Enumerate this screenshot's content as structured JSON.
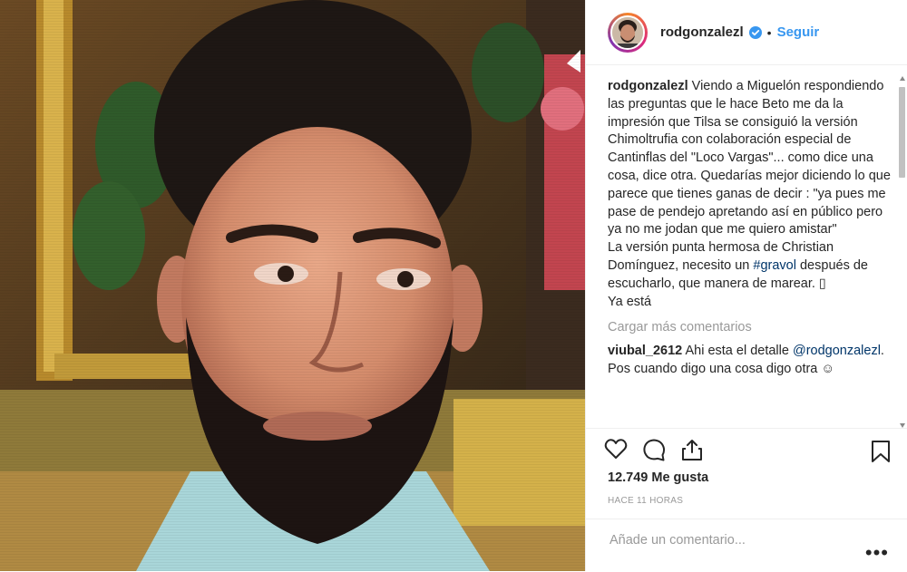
{
  "post": {
    "username": "rodgonzalezl",
    "dot": "•",
    "follow_label": "Seguir",
    "caption": "Viendo a Miguelón respondiendo las preguntas que le hace Beto me da la impresión que Tilsa se consiguió la versión Chimoltrufia con colaboración especial de Cantinflas del \"Loco Vargas\"... como dice una cosa, dice otra. Quedarías mejor diciendo lo que parece que tienes ganas de decir : \"ya pues me pase de pendejo apretando así en público pero ya no me jodan que me quiero amistar\"\nLa versión punta hermosa de Christian Domínguez, necesito un ",
    "caption_hashtag": "#gravol",
    "caption_end": " después de escucharlo, que manera de marear. ▯\nYa está",
    "load_more": "Cargar más comentarios",
    "comments": [
      {
        "username": "viubal_2612",
        "text_before": " Ahi esta el detalle ",
        "mention": "@rodgonzalezl",
        "text_after": ". Pos cuando digo una cosa digo otra ☺"
      }
    ],
    "likes": "12.749 Me gusta",
    "time": "HACE 11 HORAS",
    "add_comment_placeholder": "Añade un comentario...",
    "more_label": "•••"
  },
  "icons": {
    "verified": "verified-badge-icon",
    "like": "heart-icon",
    "comment": "comment-bubble-icon",
    "share": "share-icon",
    "save": "bookmark-icon"
  },
  "colors": {
    "link": "#3897f0",
    "verified": "#3897f0",
    "hashtag": "#003569",
    "muted": "#999999"
  }
}
